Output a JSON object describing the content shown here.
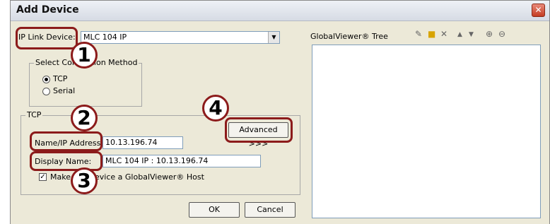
{
  "window": {
    "title": "Add Device",
    "close_glyph": "✕"
  },
  "ip_link": {
    "label": "IP Link Device:",
    "value": "MLC 104 IP"
  },
  "connection": {
    "group_title": "Select Connection Method",
    "options": [
      "TCP",
      "Serial"
    ],
    "selected": "TCP"
  },
  "tcp": {
    "group_title": "TCP",
    "address_label": "Name/IP Address:",
    "address_value": "10.13.196.74",
    "display_label": "Display Name:",
    "display_value": "MLC 104 IP : 10.13.196.74",
    "host_checkbox_label": "Make this device a GlobalViewer® Host",
    "host_checked": true
  },
  "advanced_button": "Advanced >>>",
  "ok_button": "OK",
  "cancel_button": "Cancel",
  "tree": {
    "label": "GlobalViewer® Tree",
    "toolbar_icons": [
      "edit-icon",
      "folder-icon",
      "delete-icon",
      "move-up-icon",
      "move-down-icon",
      "add-icon",
      "remove-icon"
    ]
  },
  "callouts": [
    "1",
    "2",
    "3",
    "4"
  ],
  "accent_color": "#8c1b1b"
}
